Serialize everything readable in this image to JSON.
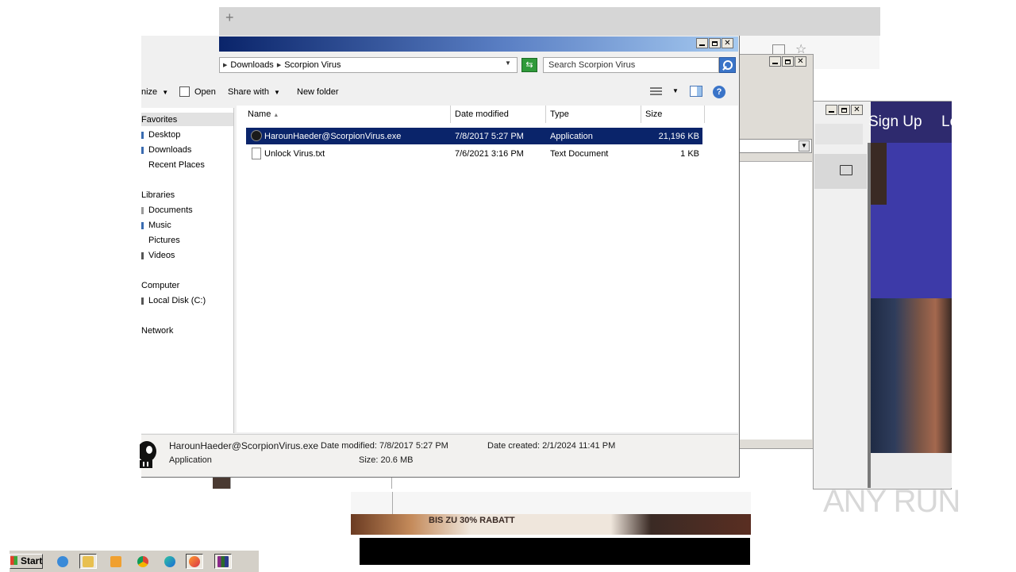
{
  "browser": {
    "newtab_symbol": "+"
  },
  "website": {
    "signup": "Sign Up",
    "login": "Lo"
  },
  "ad": {
    "text": "BIS ZU 30% RABATT"
  },
  "explorer": {
    "breadcrumb": [
      "Downloads",
      "Scorpion Virus"
    ],
    "search_placeholder": "Search Scorpion Virus",
    "commands": {
      "organize": "nize",
      "open": "Open",
      "share_with": "Share with",
      "new_folder": "New folder"
    },
    "nav": {
      "favorites": "Favorites",
      "fav_items": [
        "Desktop",
        "Downloads",
        "Recent Places"
      ],
      "libraries": "Libraries",
      "lib_items": [
        "Documents",
        "Music",
        "Pictures",
        "Videos"
      ],
      "computer": "Computer",
      "computer_items": [
        "Local Disk (C:)"
      ],
      "network": "Network"
    },
    "columns": [
      "Name",
      "Date modified",
      "Type",
      "Size"
    ],
    "files": [
      {
        "name": "HarounHaeder@ScorpionVirus.exe",
        "date": "7/8/2017 5:27 PM",
        "type": "Application",
        "size": "21,196 KB",
        "selected": true
      },
      {
        "name": "Unlock Virus.txt",
        "date": "7/6/2021 3:16 PM",
        "type": "Text Document",
        "size": "1 KB",
        "selected": false
      }
    ],
    "details": {
      "name": "HarounHaeder@ScorpionVirus.exe",
      "kind": "Application",
      "date_modified": "Date modified: 7/8/2017 5:27 PM",
      "size": "Size: 20.6 MB",
      "date_created": "Date created: 2/1/2024 11:41 PM"
    }
  },
  "taskbar": {
    "start": "Start"
  },
  "watermark": "ANY RUN"
}
